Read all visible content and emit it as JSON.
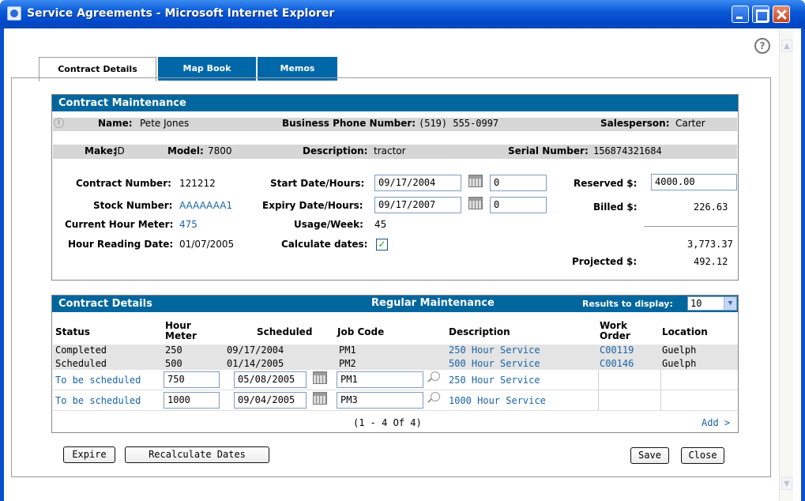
{
  "window": {
    "title": "Service Agreements - Microsoft Internet Explorer"
  },
  "tabs": [
    {
      "label": "Contract Details"
    },
    {
      "label": "Map Book"
    },
    {
      "label": "Memos"
    }
  ],
  "help_label": "?",
  "maintenance": {
    "header": "Contract Maintenance",
    "info_icon_label": "i",
    "name_label": "Name:",
    "name_value": "Pete Jones",
    "phone_label": "Business Phone Number:",
    "phone_value": "(519) 555-0997",
    "sales_label": "Salesperson:",
    "sales_value": "Carter",
    "make_label": "Make:",
    "make_value": "JD",
    "model_label": "Model:",
    "model_value": "7800",
    "desc_label": "Description:",
    "desc_value": "tractor",
    "serial_label": "Serial Number:",
    "serial_value": "156874321684",
    "contract_number_label": "Contract Number:",
    "contract_number_value": "121212",
    "stock_number_label": "Stock Number:",
    "stock_number_value": "AAAAAAA1",
    "current_hour_label": "Current Hour Meter:",
    "current_hour_value": "475",
    "reading_date_label": "Hour Reading Date:",
    "reading_date_value": "01/07/2005",
    "start_label": "Start Date/Hours:",
    "start_date": "09/17/2004",
    "start_hours": "0",
    "expiry_label": "Expiry Date/Hours:",
    "expiry_date": "09/17/2007",
    "expiry_hours": "0",
    "usage_label": "Usage/Week:",
    "usage_value": "45",
    "calc_label": "Calculate dates:",
    "calc_checked": "✓",
    "reserved_label": "Reserved $:",
    "reserved_value": "4000.00",
    "billed_label": "Billed $:",
    "billed_value": "226.63",
    "remaining_value": "3,773.37",
    "projected_label": "Projected $:",
    "projected_value": "492.12"
  },
  "details": {
    "header": "Contract Details",
    "center_title": "Regular Maintenance",
    "results_label": "Results to display:",
    "results_value": "10",
    "columns": {
      "status": "Status",
      "hour_meter": "Hour\nMeter",
      "scheduled": "Scheduled",
      "job_code": "Job Code",
      "description": "Description",
      "work_order": "Work\nOrder",
      "location": "Location"
    },
    "rows": [
      {
        "status": "Completed",
        "hour": "250",
        "scheduled": "09/17/2004",
        "job": "PM1",
        "description": "250 Hour Service",
        "work_order": "C00119",
        "location": "Guelph"
      },
      {
        "status": "Scheduled",
        "hour": "500",
        "scheduled": "01/14/2005",
        "job": "PM2",
        "description": "500 Hour Service",
        "work_order": "C00146",
        "location": "Guelph"
      },
      {
        "status": "To be scheduled",
        "hour": "750",
        "scheduled": "05/08/2005",
        "job": "PM1",
        "description": "250 Hour Service",
        "work_order": "",
        "location": ""
      },
      {
        "status": "To be scheduled",
        "hour": "1000",
        "scheduled": "09/04/2005",
        "job": "PM3",
        "description": "1000 Hour Service",
        "work_order": "",
        "location": ""
      }
    ],
    "pager": "(1 - 4 Of 4)",
    "add_link": "Add >"
  },
  "buttons": {
    "expire": "Expire",
    "recalc": "Recalculate Dates",
    "save": "Save",
    "close": "Close"
  },
  "colors": {
    "header_blue": "#00669e",
    "title_blue": "#0a5ad8",
    "link_blue": "#1a64a8"
  }
}
